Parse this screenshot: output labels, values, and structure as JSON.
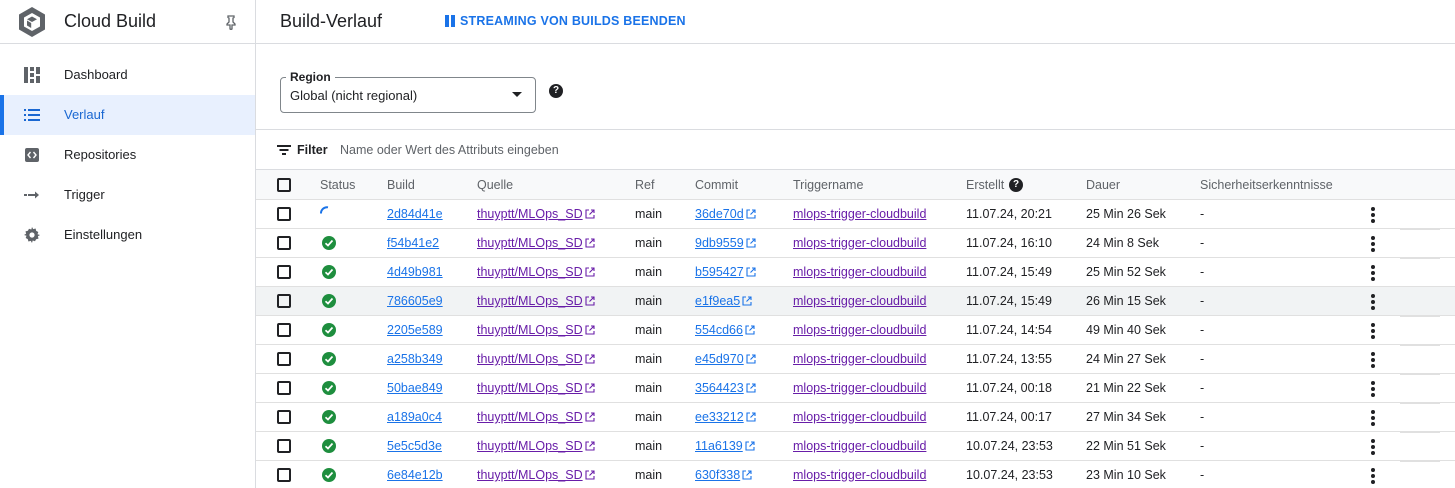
{
  "app": {
    "title": "Cloud Build"
  },
  "sidebar": {
    "items": [
      {
        "label": "Dashboard",
        "icon": "dashboard-icon",
        "active": false
      },
      {
        "label": "Verlauf",
        "icon": "list-icon",
        "active": true
      },
      {
        "label": "Repositories",
        "icon": "code-icon",
        "active": false
      },
      {
        "label": "Trigger",
        "icon": "trigger-arrow-icon",
        "active": false
      },
      {
        "label": "Einstellungen",
        "icon": "gear-icon",
        "active": false
      }
    ]
  },
  "header": {
    "title": "Build-Verlauf",
    "stream_button": "STREAMING VON BUILDS BEENDEN"
  },
  "region": {
    "label": "Region",
    "value": "Global (nicht regional)"
  },
  "filter": {
    "label": "Filter",
    "placeholder": "Name oder Wert des Attributs eingeben"
  },
  "table": {
    "columns": [
      "Status",
      "Build",
      "Quelle",
      "Ref",
      "Commit",
      "Triggername",
      "Erstellt",
      "Dauer",
      "Sicherheitserkenntnisse"
    ],
    "rows": [
      {
        "status": "running",
        "build": "2d84d41e",
        "source": "thuyptt/MLOps_SD",
        "ref": "main",
        "commit": "36de70d",
        "trigger": "mlops-trigger-cloudbuild",
        "created": "11.07.24, 20:21",
        "duration": "25 Min 26 Sek",
        "security": "-"
      },
      {
        "status": "success",
        "build": "f54b41e2",
        "source": "thuyptt/MLOps_SD",
        "ref": "main",
        "commit": "9db9559",
        "trigger": "mlops-trigger-cloudbuild",
        "created": "11.07.24, 16:10",
        "duration": "24 Min 8 Sek",
        "security": "-"
      },
      {
        "status": "success",
        "build": "4d49b981",
        "source": "thuyptt/MLOps_SD",
        "ref": "main",
        "commit": "b595427",
        "trigger": "mlops-trigger-cloudbuild",
        "created": "11.07.24, 15:49",
        "duration": "25 Min 52 Sek",
        "security": "-"
      },
      {
        "status": "success",
        "build": "786605e9",
        "source": "thuyptt/MLOps_SD",
        "ref": "main",
        "commit": "e1f9ea5",
        "trigger": "mlops-trigger-cloudbuild",
        "created": "11.07.24, 15:49",
        "duration": "26 Min 15 Sek",
        "security": "-"
      },
      {
        "status": "success",
        "build": "2205e589",
        "source": "thuyptt/MLOps_SD",
        "ref": "main",
        "commit": "554cd66",
        "trigger": "mlops-trigger-cloudbuild",
        "created": "11.07.24, 14:54",
        "duration": "49 Min 40 Sek",
        "security": "-"
      },
      {
        "status": "success",
        "build": "a258b349",
        "source": "thuyptt/MLOps_SD",
        "ref": "main",
        "commit": "e45d970",
        "trigger": "mlops-trigger-cloudbuild",
        "created": "11.07.24, 13:55",
        "duration": "24 Min 27 Sek",
        "security": "-"
      },
      {
        "status": "success",
        "build": "50bae849",
        "source": "thuyptt/MLOps_SD",
        "ref": "main",
        "commit": "3564423",
        "trigger": "mlops-trigger-cloudbuild",
        "created": "11.07.24, 00:18",
        "duration": "21 Min 22 Sek",
        "security": "-"
      },
      {
        "status": "success",
        "build": "a189a0c4",
        "source": "thuyptt/MLOps_SD",
        "ref": "main",
        "commit": "ee33212",
        "trigger": "mlops-trigger-cloudbuild",
        "created": "11.07.24, 00:17",
        "duration": "27 Min 34 Sek",
        "security": "-"
      },
      {
        "status": "success",
        "build": "5e5c5d3e",
        "source": "thuyptt/MLOps_SD",
        "ref": "main",
        "commit": "11a6139",
        "trigger": "mlops-trigger-cloudbuild",
        "created": "10.07.24, 23:53",
        "duration": "22 Min 51 Sek",
        "security": "-"
      },
      {
        "status": "success",
        "build": "6e84e12b",
        "source": "thuyptt/MLOps_SD",
        "ref": "main",
        "commit": "630f338",
        "trigger": "mlops-trigger-cloudbuild",
        "created": "10.07.24, 23:53",
        "duration": "23 Min 10 Sek",
        "security": "-"
      }
    ]
  },
  "colors": {
    "accent": "#1a73e8",
    "success": "#1e8e3e",
    "visited_link": "#681da8"
  }
}
